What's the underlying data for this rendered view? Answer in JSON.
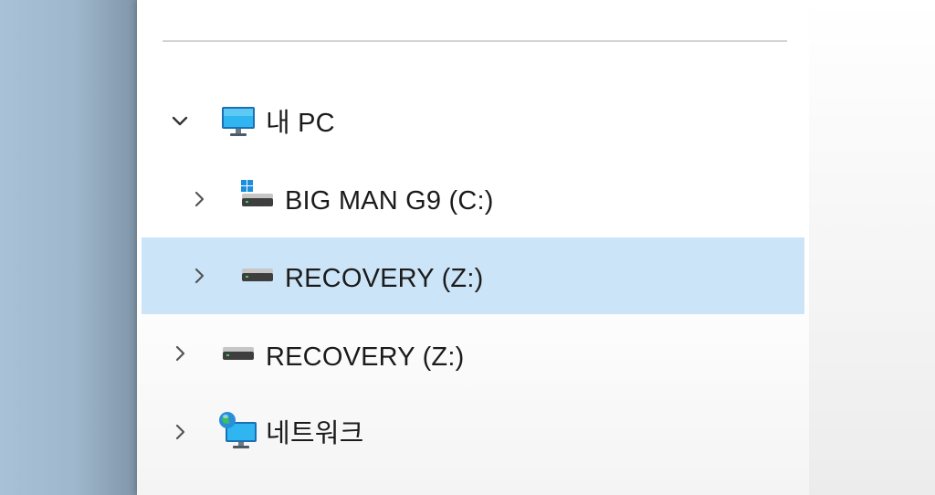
{
  "nav": {
    "items": [
      {
        "label": "내 PC",
        "icon": "computer-icon",
        "expanded": true
      },
      {
        "label": "BIG MAN G9 (C:)",
        "icon": "windows-drive-icon",
        "expanded": false
      },
      {
        "label": "RECOVERY (Z:)",
        "icon": "drive-icon",
        "expanded": false,
        "selected": true
      },
      {
        "label": "RECOVERY (Z:)",
        "icon": "drive-icon",
        "expanded": false
      },
      {
        "label": "네트워크",
        "icon": "network-icon",
        "expanded": false
      }
    ]
  },
  "colors": {
    "selection": "#cce4f7",
    "text": "#1b1b1b",
    "chevron": "#555555"
  }
}
